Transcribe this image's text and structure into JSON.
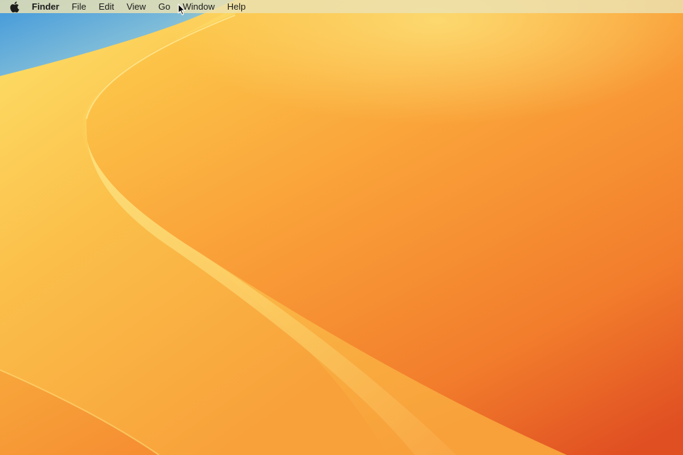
{
  "menubar": {
    "apple_icon": "apple-logo-icon",
    "app_name": "Finder",
    "items": [
      {
        "label": "File"
      },
      {
        "label": "Edit"
      },
      {
        "label": "View"
      },
      {
        "label": "Go"
      },
      {
        "label": "Window"
      },
      {
        "label": "Help"
      }
    ]
  },
  "desktop": {
    "wallpaper": "orange-desert-dunes-wallpaper",
    "colors": {
      "sky": "#4a9fd9",
      "light_sand": "#fbd860",
      "mid_sand": "#f9a73a",
      "deep_orange": "#e85a25"
    }
  },
  "cursor": {
    "icon": "arrow-pointer-icon"
  }
}
